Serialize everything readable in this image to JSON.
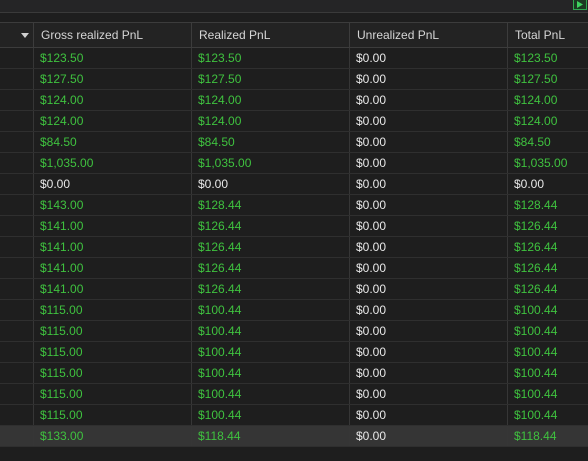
{
  "colors": {
    "positive": "#3fc23f",
    "neutral": "#e8e8e8",
    "background": "#1e1e1e",
    "selected_row": "#353535"
  },
  "icons": {
    "sort": "chevron-down-icon",
    "corner": "play-icon"
  },
  "table": {
    "columns": [
      "Gross realized PnL",
      "Realized PnL",
      "Unrealized PnL",
      "Total PnL"
    ],
    "rows": [
      [
        "$123.50",
        "$123.50",
        "$0.00",
        "$123.50"
      ],
      [
        "$127.50",
        "$127.50",
        "$0.00",
        "$127.50"
      ],
      [
        "$124.00",
        "$124.00",
        "$0.00",
        "$124.00"
      ],
      [
        "$124.00",
        "$124.00",
        "$0.00",
        "$124.00"
      ],
      [
        "$84.50",
        "$84.50",
        "$0.00",
        "$84.50"
      ],
      [
        "$1,035.00",
        "$1,035.00",
        "$0.00",
        "$1,035.00"
      ],
      [
        "$0.00",
        "$0.00",
        "$0.00",
        "$0.00"
      ],
      [
        "$143.00",
        "$128.44",
        "$0.00",
        "$128.44"
      ],
      [
        "$141.00",
        "$126.44",
        "$0.00",
        "$126.44"
      ],
      [
        "$141.00",
        "$126.44",
        "$0.00",
        "$126.44"
      ],
      [
        "$141.00",
        "$126.44",
        "$0.00",
        "$126.44"
      ],
      [
        "$141.00",
        "$126.44",
        "$0.00",
        "$126.44"
      ],
      [
        "$115.00",
        "$100.44",
        "$0.00",
        "$100.44"
      ],
      [
        "$115.00",
        "$100.44",
        "$0.00",
        "$100.44"
      ],
      [
        "$115.00",
        "$100.44",
        "$0.00",
        "$100.44"
      ],
      [
        "$115.00",
        "$100.44",
        "$0.00",
        "$100.44"
      ],
      [
        "$115.00",
        "$100.44",
        "$0.00",
        "$100.44"
      ],
      [
        "$115.00",
        "$100.44",
        "$0.00",
        "$100.44"
      ],
      [
        "$133.00",
        "$118.44",
        "$0.00",
        "$118.44"
      ]
    ],
    "selected_row": 18
  }
}
